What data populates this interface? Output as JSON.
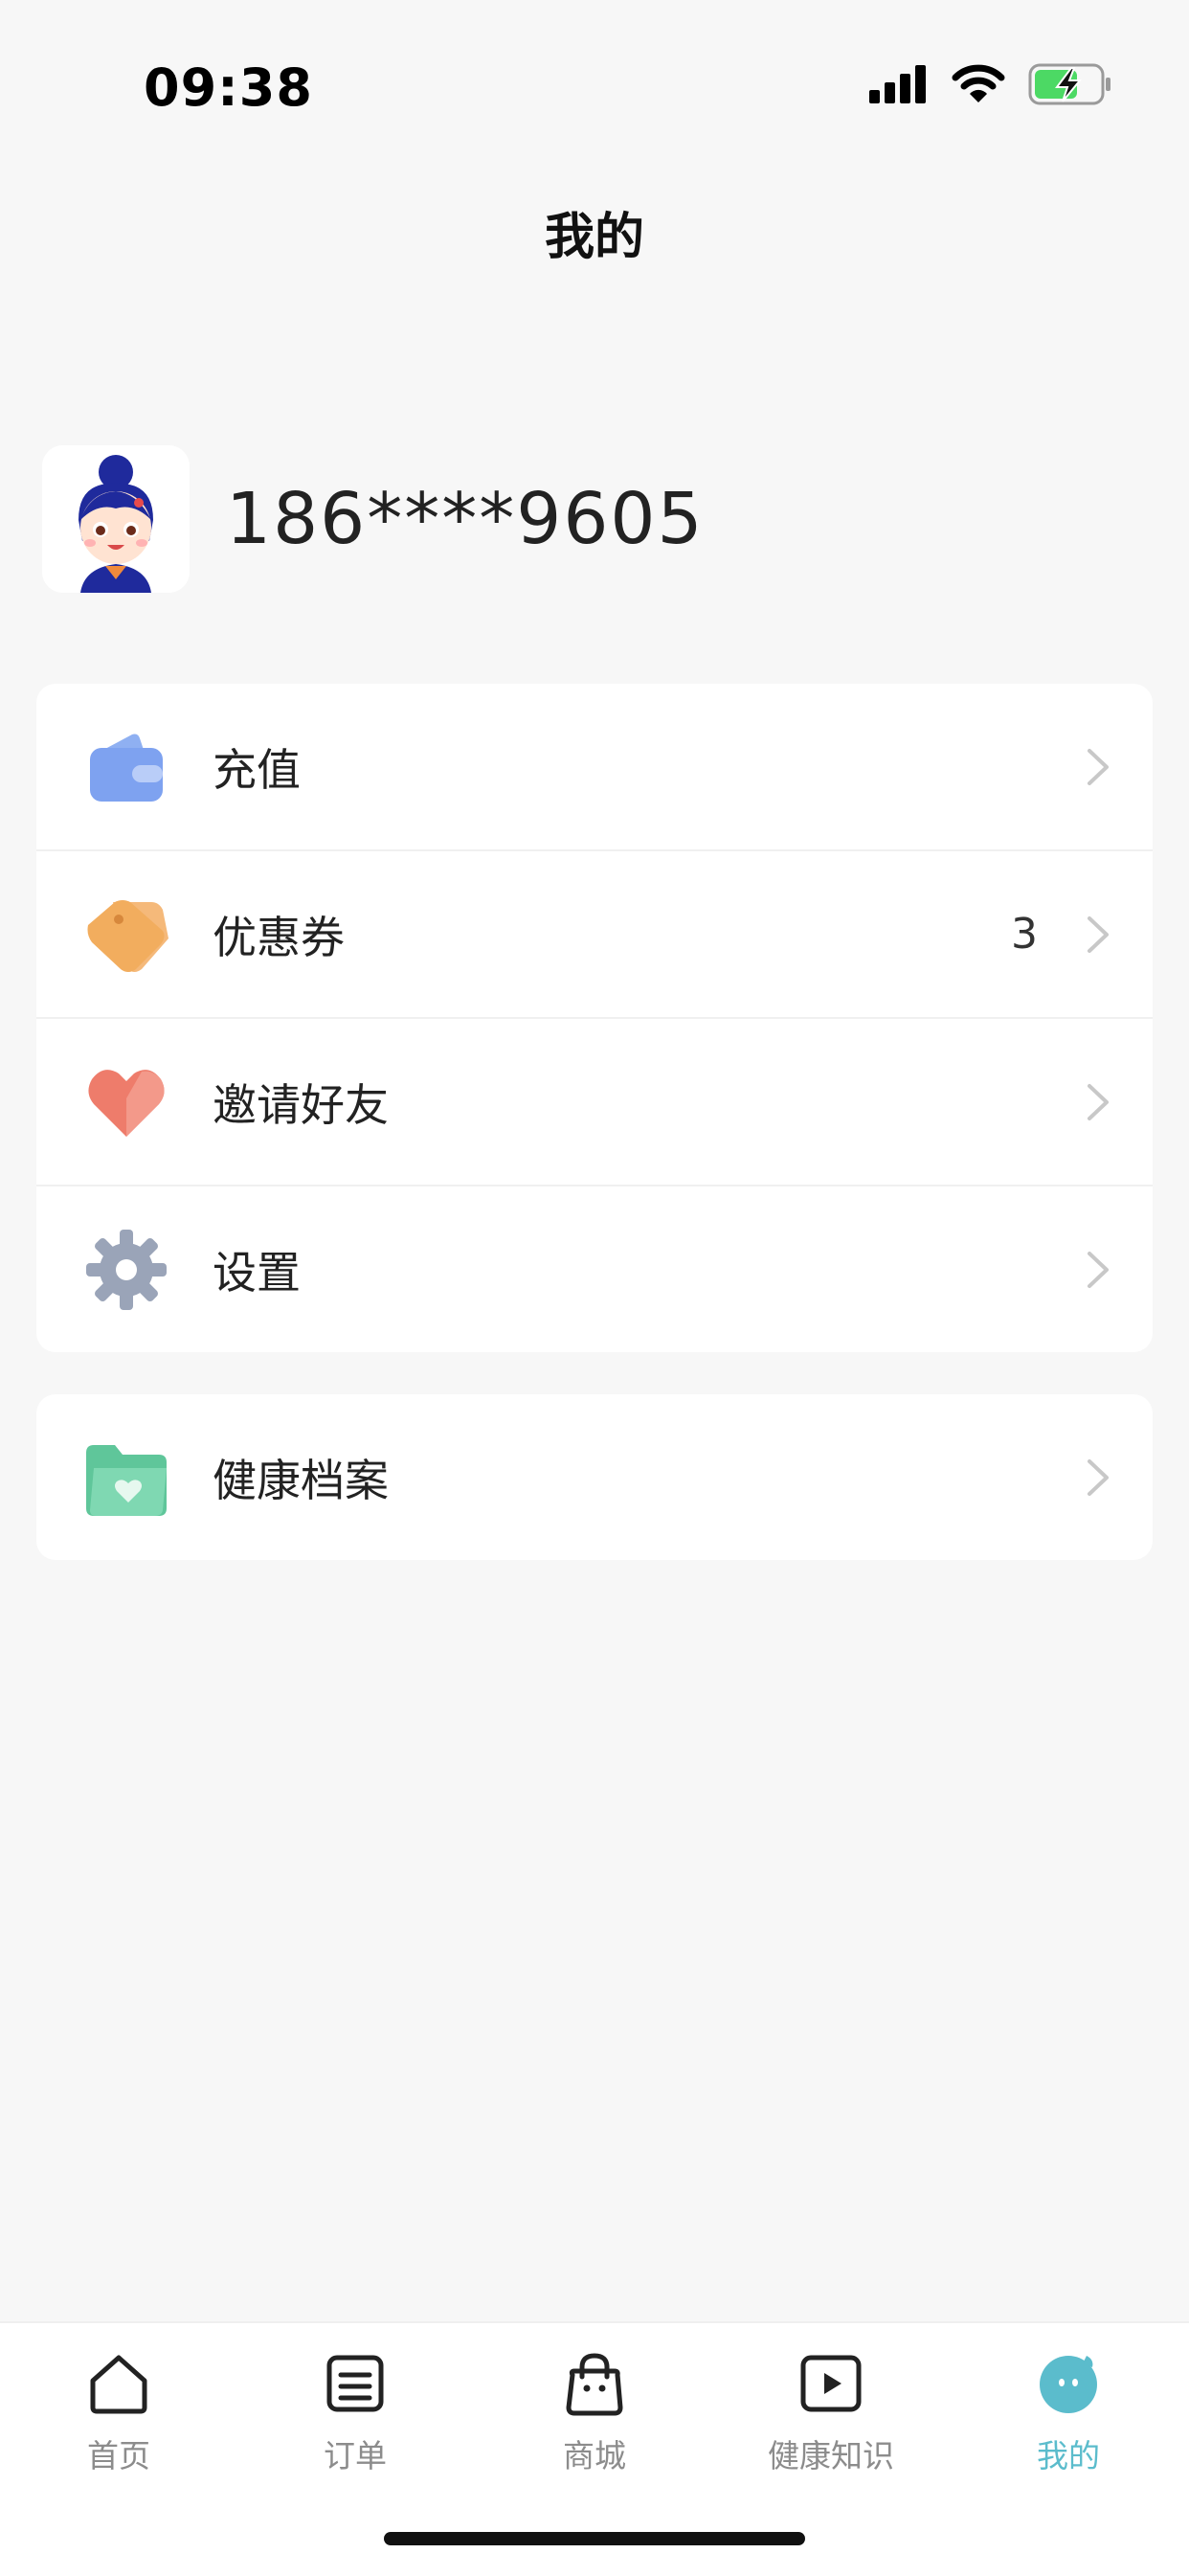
{
  "status_bar": {
    "time": "09:38"
  },
  "header": {
    "title": "我的"
  },
  "profile": {
    "phone": "186****9605"
  },
  "menu_group_1": [
    {
      "label": "充值",
      "icon": "wallet-icon",
      "badge": ""
    },
    {
      "label": "优惠券",
      "icon": "coupon-tag-icon",
      "badge": "3"
    },
    {
      "label": "邀请好友",
      "icon": "heart-icon",
      "badge": ""
    },
    {
      "label": "设置",
      "icon": "gear-icon",
      "badge": ""
    }
  ],
  "menu_group_2": [
    {
      "label": "健康档案",
      "icon": "health-folder-icon",
      "badge": ""
    }
  ],
  "tabbar": [
    {
      "label": "首页",
      "icon": "home-icon"
    },
    {
      "label": "订单",
      "icon": "order-icon"
    },
    {
      "label": "商城",
      "icon": "shopping-bag-icon"
    },
    {
      "label": "健康知识",
      "icon": "video-play-icon"
    },
    {
      "label": "我的",
      "icon": "profile-face-icon",
      "active": true
    }
  ],
  "colors": {
    "accent": "#5bbccc",
    "background": "#f7f7f7"
  }
}
